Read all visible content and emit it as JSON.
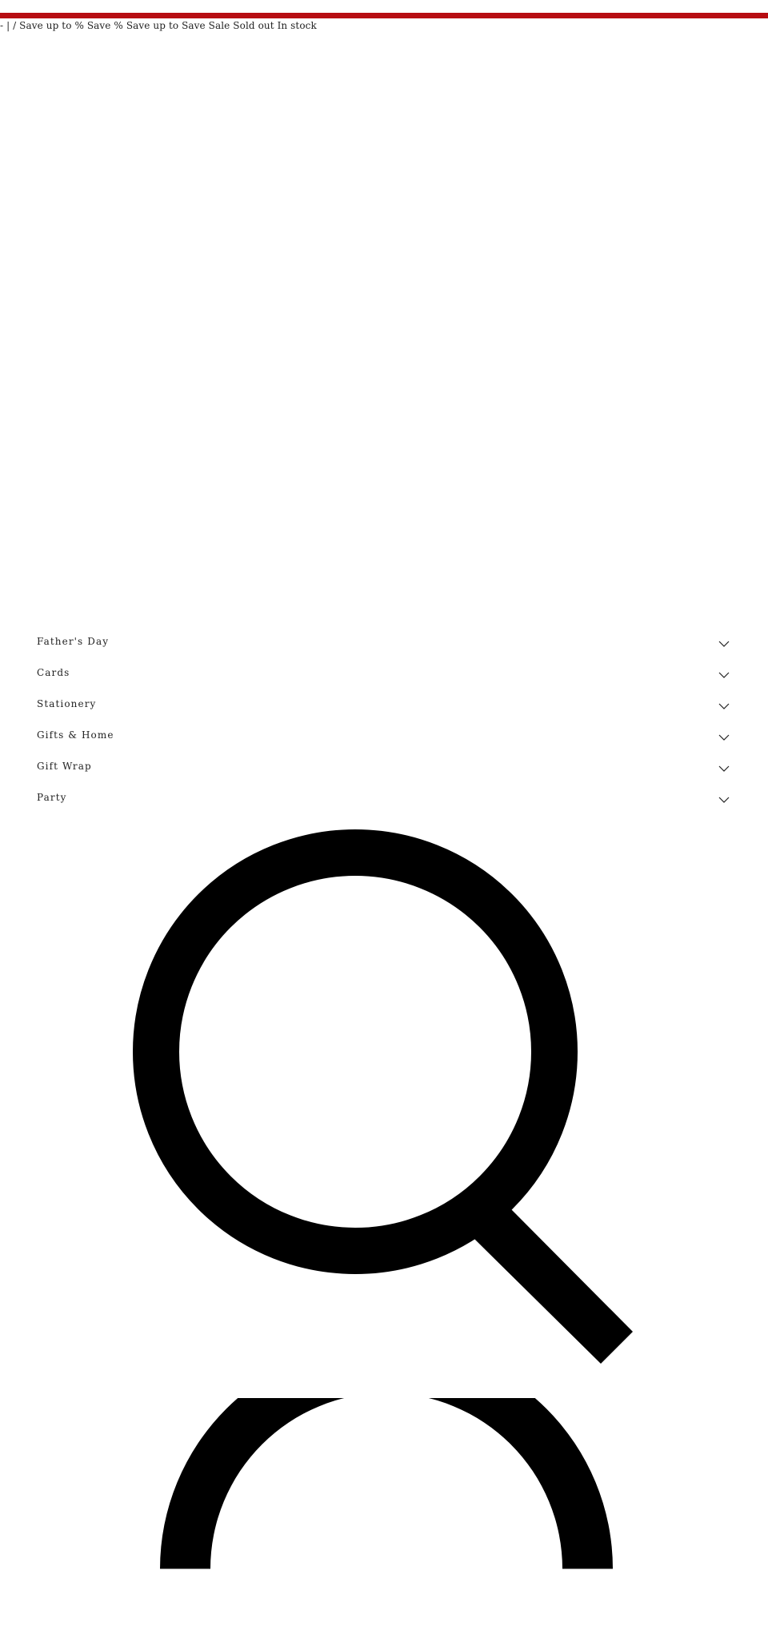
{
  "price_strip": {
    "text": "- | / Save up to % Save % Save up to Save Sale Sold out In stock"
  },
  "navigation": {
    "items": [
      {
        "label": "Father's Day"
      },
      {
        "label": "Cards"
      },
      {
        "label": "Stationery"
      },
      {
        "label": "Gifts & Home"
      },
      {
        "label": "Gift Wrap"
      },
      {
        "label": "Party"
      }
    ]
  },
  "icons": {
    "chevron": "chevron-down-icon",
    "search": "search-icon"
  },
  "colors": {
    "top_bar": "#b70d12",
    "text": "#222222",
    "icon": "#000000",
    "background": "#ffffff"
  }
}
